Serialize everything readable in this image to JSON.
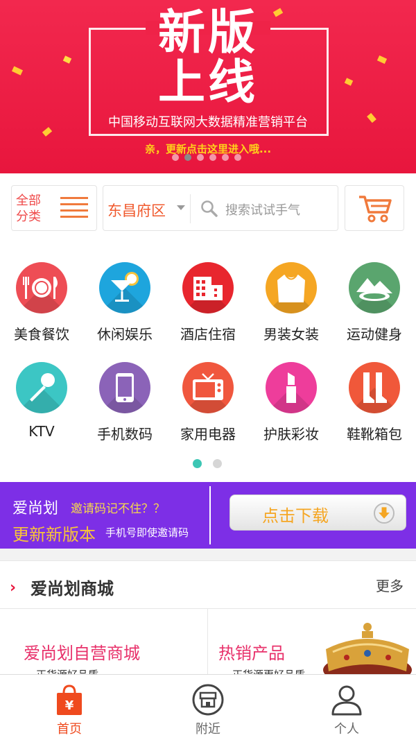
{
  "banner": {
    "headline_1": "新版",
    "headline_2": "上线",
    "subtitle": "中国移动互联网大数据精准营销平台",
    "teaser": "亲，更新点击这里进入哦...",
    "slide_count": 6,
    "active_slide": 2
  },
  "toolbar": {
    "category_label": "全部分类",
    "location": "东昌府区",
    "search_placeholder": "搜索试试手气"
  },
  "categories": [
    {
      "label": "美食餐饮",
      "icon": "dining-icon",
      "color": "#ee4d55"
    },
    {
      "label": "休闲娱乐",
      "icon": "cocktail-icon",
      "color": "#1ea5dd"
    },
    {
      "label": "酒店住宿",
      "icon": "hotel-icon",
      "color": "#e8262e"
    },
    {
      "label": "男装女装",
      "icon": "shirt-icon",
      "color": "#f5a623"
    },
    {
      "label": "运动健身",
      "icon": "mountain-icon",
      "color": "#5aa56e"
    },
    {
      "label": "KTV",
      "icon": "microphone-icon",
      "color": "#3cc6c4"
    },
    {
      "label": "手机数码",
      "icon": "phone-icon",
      "color": "#8b63b8"
    },
    {
      "label": "家用电器",
      "icon": "tv-icon",
      "color": "#f0573e"
    },
    {
      "label": "护肤彩妆",
      "icon": "lipstick-icon",
      "color": "#ee3d9b"
    },
    {
      "label": "鞋靴箱包",
      "icon": "boots-icon",
      "color": "#f0583a"
    }
  ],
  "category_pager": {
    "pages": 2,
    "active": 1
  },
  "promo": {
    "brand": "爱尚划",
    "question": "邀请码记不住？？",
    "update": "更新新版本",
    "hint": "手机号即使邀请码",
    "download_label": "点击下载"
  },
  "mall": {
    "title": "爱尚划商城",
    "more": "更多",
    "cells": [
      {
        "title": "爱尚划自营商城",
        "subtitle": "正货源好品质"
      },
      {
        "title": "热销产品",
        "subtitle": "正货源更好品质"
      }
    ]
  },
  "tabs": [
    {
      "label": "首页",
      "icon": "shopping-bag-icon",
      "active": true
    },
    {
      "label": "附近",
      "icon": "store-icon",
      "active": false
    },
    {
      "label": "个人",
      "icon": "person-icon",
      "active": false
    }
  ]
}
